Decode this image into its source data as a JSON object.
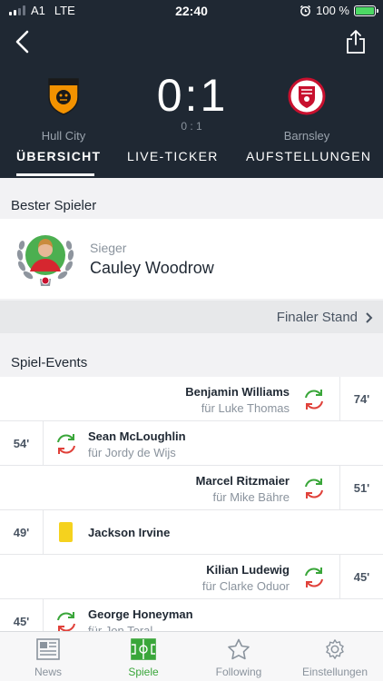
{
  "status_bar": {
    "carrier": "A1",
    "network": "LTE",
    "time": "22:40",
    "battery": "100 %"
  },
  "match": {
    "home_team": "Hull City",
    "away_team": "Barnsley",
    "home_score": "0",
    "away_score": "1",
    "score_separator": ":",
    "halftime_score": "0 : 1"
  },
  "tabs": [
    {
      "label": "ÜBERSICHT",
      "active": true
    },
    {
      "label": "LIVE-TICKER",
      "active": false
    },
    {
      "label": "AUFSTELLUNGEN",
      "active": false
    }
  ],
  "best_player": {
    "section_title": "Bester Spieler",
    "caption": "Sieger",
    "name": "Cauley Woodrow"
  },
  "final_standing": {
    "label": "Finaler Stand"
  },
  "events_section": {
    "title": "Spiel-Events"
  },
  "events": [
    {
      "side": "right",
      "type": "substitution",
      "minute": "74'",
      "player_in": "Benjamin Williams",
      "player_out": "für Luke Thomas"
    },
    {
      "side": "left",
      "type": "substitution",
      "minute": "54'",
      "player_in": "Sean McLoughlin",
      "player_out": "für Jordy de Wijs"
    },
    {
      "side": "right",
      "type": "substitution",
      "minute": "51'",
      "player_in": "Marcel Ritzmaier",
      "player_out": "für Mike Bähre"
    },
    {
      "side": "left",
      "type": "yellow-card",
      "minute": "49'",
      "player": "Jackson Irvine"
    },
    {
      "side": "right",
      "type": "substitution",
      "minute": "45'",
      "player_in": "Kilian Ludewig",
      "player_out": "für Clarke Oduor"
    },
    {
      "side": "left",
      "type": "substitution",
      "minute": "45'",
      "player_in": "George Honeyman",
      "player_out": "für Jon Toral"
    }
  ],
  "bottom_nav": [
    {
      "label": "News",
      "icon": "news-icon",
      "active": false
    },
    {
      "label": "Spiele",
      "icon": "pitch-icon",
      "active": true
    },
    {
      "label": "Following",
      "icon": "star-icon",
      "active": false
    },
    {
      "label": "Einstellungen",
      "icon": "gear-icon",
      "active": false
    }
  ],
  "colors": {
    "header_bg": "#1f2833",
    "accent_green": "#3aa63a",
    "sub_in_green": "#3aa63a",
    "sub_out_red": "#e0413a",
    "yellow_card": "#f5d21e"
  }
}
